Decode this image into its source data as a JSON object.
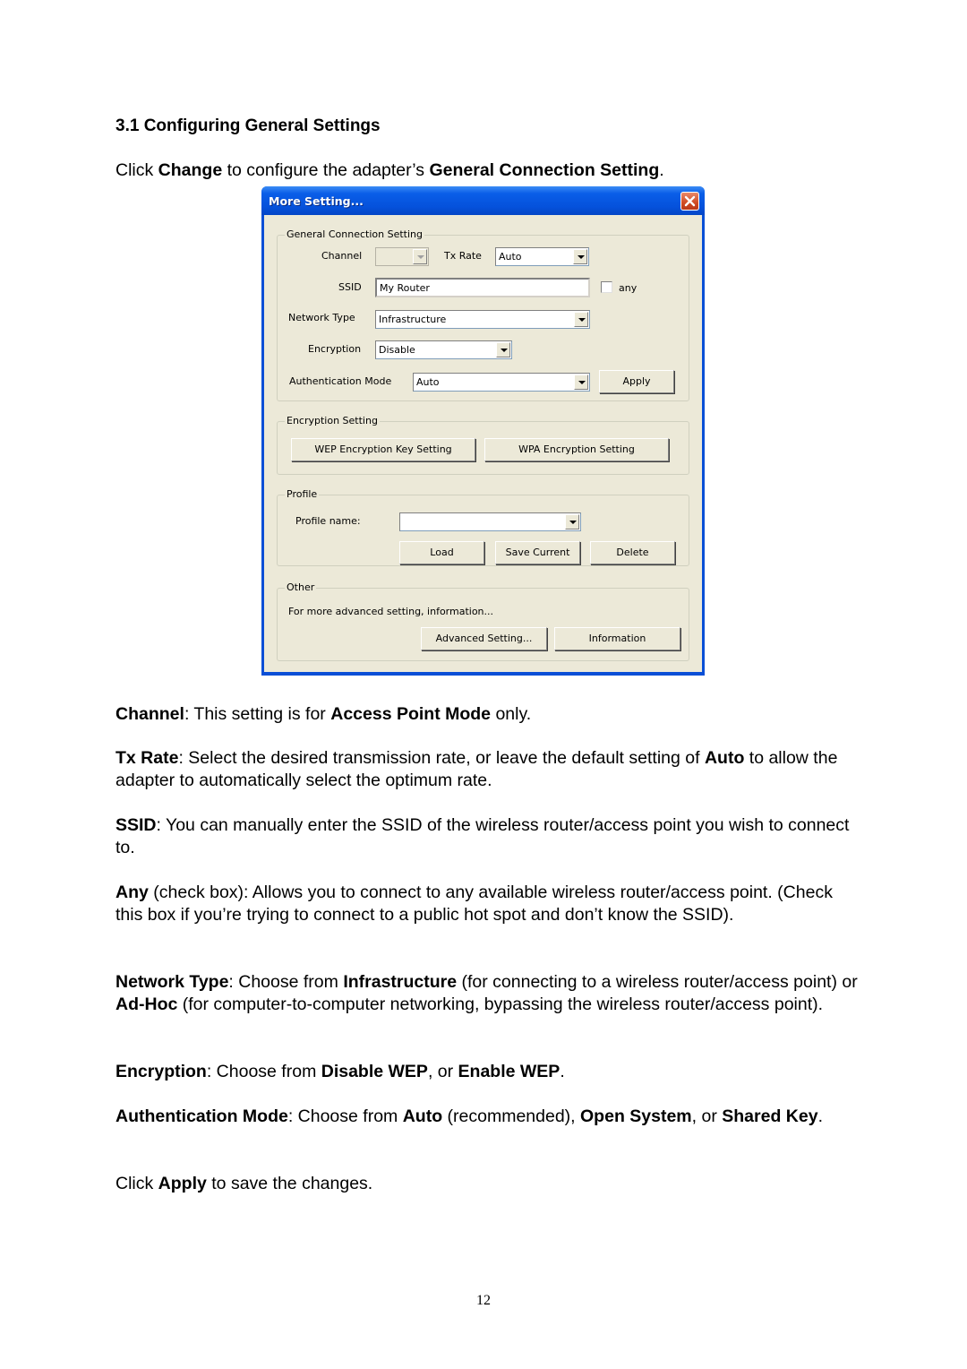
{
  "document": {
    "heading": "3.1 Configuring General Settings",
    "intro": [
      {
        "t": "Click "
      },
      {
        "b": "Change"
      },
      {
        "t": " to configure the adapter’s "
      },
      {
        "b": "General Connection Setting"
      },
      {
        "t": "."
      }
    ],
    "paragraphs": [
      [
        {
          "b": "Channel"
        },
        {
          "t": ": This setting is for "
        },
        {
          "b": "Access Point Mode"
        },
        {
          "t": " only."
        }
      ],
      [
        {
          "b": "Tx Rate"
        },
        {
          "t": ": Select the desired transmission rate, or leave the default setting of "
        },
        {
          "b": "Auto"
        },
        {
          "t": " to allow the adapter to automatically select the optimum rate."
        }
      ],
      [
        {
          "b": "SSID"
        },
        {
          "t": ": You can manually enter the SSID of the wireless router/access point you wish to connect to."
        }
      ],
      [
        {
          "b": "Any"
        },
        {
          "t": " (check box): Allows you to connect to any available wireless router/access point. (Check this box if you’re trying to connect to a public hot spot and don’t know the SSID)."
        }
      ],
      [
        {
          "b": "Network Type"
        },
        {
          "t": ": Choose from "
        },
        {
          "b": "Infrastructure"
        },
        {
          "t": " (for connecting to a wireless router/access point) or "
        },
        {
          "b": "Ad-Hoc"
        },
        {
          "t": " (for computer-to-computer networking, bypassing the wireless router/access point)."
        }
      ],
      [
        {
          "b": "Encryption"
        },
        {
          "t": ": Choose from "
        },
        {
          "b": "Disable WEP"
        },
        {
          "t": ", or "
        },
        {
          "b": "Enable WEP"
        },
        {
          "t": "."
        }
      ],
      [
        {
          "b": "Authentication Mode"
        },
        {
          "t": ": Choose from "
        },
        {
          "b": "Auto"
        },
        {
          "t": " (recommended), "
        },
        {
          "b": "Open System"
        },
        {
          "t": ", or "
        },
        {
          "b": "Shared Key"
        },
        {
          "t": "."
        }
      ],
      [
        {
          "t": "Click "
        },
        {
          "b": "Apply"
        },
        {
          "t": " to save the changes."
        }
      ]
    ],
    "page_number": "12"
  },
  "dialog": {
    "title": "More Setting...",
    "close_icon": "close-icon",
    "general": {
      "legend": "General Connection Setting",
      "channel_label": "Channel",
      "channel_value": "",
      "txrate_label": "Tx Rate",
      "txrate_value": "Auto",
      "ssid_label": "SSID",
      "ssid_value": "My Router",
      "any_label": "any",
      "any_checked": false,
      "network_type_label": "Network Type",
      "network_type_value": "Infrastructure",
      "encryption_label": "Encryption",
      "encryption_value": "Disable",
      "auth_label": "Authentication Mode",
      "auth_value": "Auto",
      "apply_label": "Apply"
    },
    "encryption": {
      "legend": "Encryption Setting",
      "wep_label": "WEP Encryption Key Setting",
      "wpa_label": "WPA Encryption Setting"
    },
    "profile": {
      "legend": "Profile",
      "name_label": "Profile name:",
      "name_value": "",
      "load_label": "Load",
      "save_label": "Save Current",
      "delete_label": "Delete"
    },
    "other": {
      "legend": "Other",
      "description": "For more advanced setting, information...",
      "advanced_label": "Advanced Setting...",
      "information_label": "Information"
    }
  }
}
